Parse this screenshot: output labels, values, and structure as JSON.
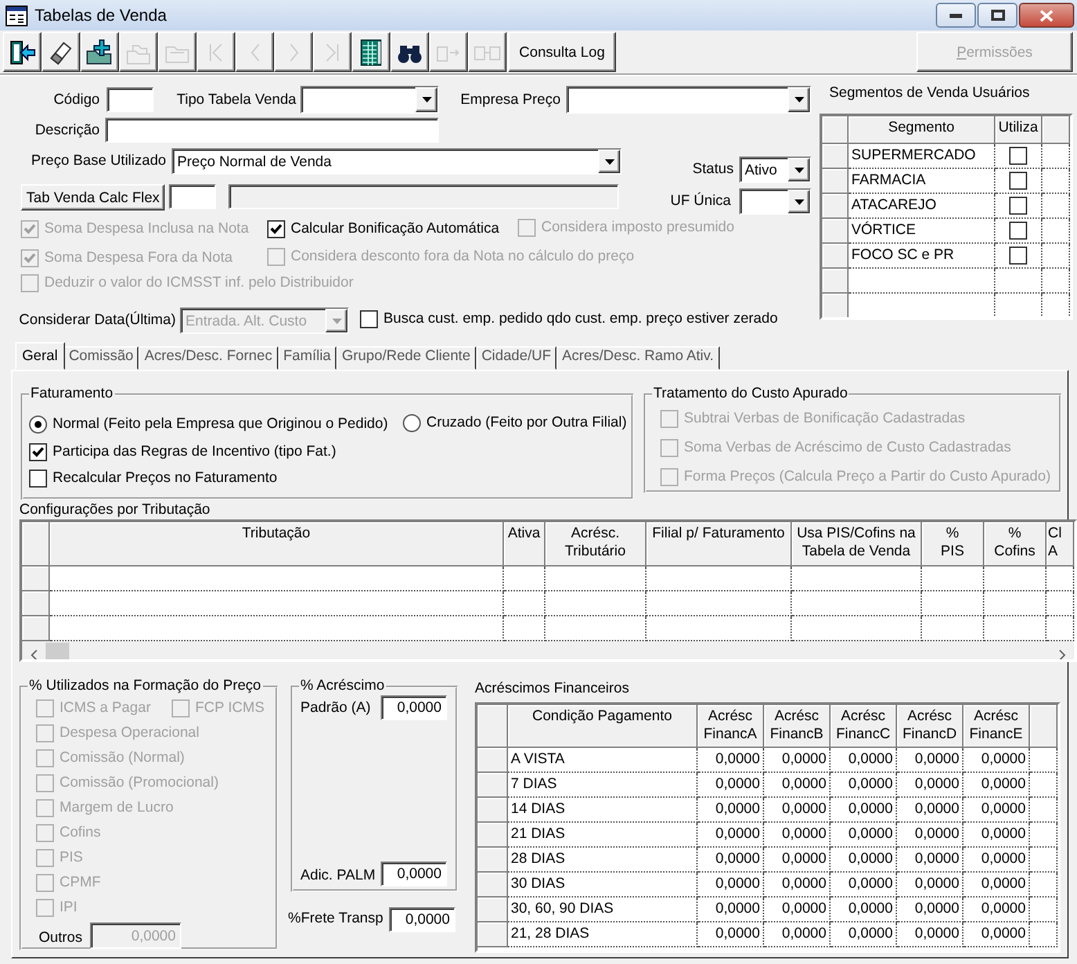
{
  "window": {
    "title": "Tabelas de Venda"
  },
  "toolbar": {
    "buttons": [
      {
        "kind": "exit",
        "disabled": false
      },
      {
        "kind": "eraser",
        "disabled": false
      },
      {
        "kind": "folder_add",
        "disabled": false
      },
      {
        "kind": "folder_edit",
        "disabled": true
      },
      {
        "kind": "folder_remove",
        "disabled": true
      },
      {
        "kind": "first",
        "disabled": true
      },
      {
        "kind": "previous",
        "disabled": true
      },
      {
        "kind": "next",
        "disabled": true
      },
      {
        "kind": "last",
        "disabled": true
      },
      {
        "kind": "grid",
        "disabled": false
      },
      {
        "kind": "find",
        "disabled": false
      },
      {
        "kind": "export",
        "disabled": true
      },
      {
        "kind": "transfer",
        "disabled": true
      },
      {
        "kind": "text",
        "label": "Consulta Log",
        "disabled": false
      }
    ],
    "permissions": {
      "label": "Permissões",
      "disabled": true
    }
  },
  "form": {
    "code": {
      "label": "Código"
    },
    "table_type": {
      "label": "Tipo Tabela Venda"
    },
    "price_company": {
      "label": "Empresa Preço"
    },
    "description": {
      "label": "Descrição"
    },
    "base_price": {
      "label": "Preço Base Utilizado",
      "value": "Preço Normal de Venda"
    },
    "status": {
      "label": "Status",
      "value": "Ativo"
    },
    "calc_flex": {
      "button": "Tab Venda Calc Flex"
    },
    "single_uf": {
      "label": "UF Única"
    },
    "options": [
      {
        "label": "Soma Despesa Inclusa na Nota",
        "checked": true,
        "disabled": true
      },
      {
        "label": "Calcular Bonificação Automática",
        "checked": true,
        "disabled": false
      },
      {
        "label": "Considera imposto presumido",
        "checked": false,
        "disabled": true
      },
      {
        "label": "Soma Despesa Fora da Nota",
        "checked": true,
        "disabled": true
      },
      {
        "label": "Considera desconto fora da Nota no cálculo do preço",
        "checked": false,
        "disabled": true
      },
      {
        "label": "Deduzir o valor do ICMSST inf. pelo Distribuidor",
        "checked": false,
        "disabled": true
      }
    ],
    "date_basis": {
      "label": "Considerar Data(Última)",
      "value": "Entrada. Alt. Custo",
      "disabled": true
    },
    "zero_cost_search": {
      "label": "Busca cust. emp. pedido qdo cust. emp. preço estiver zerado",
      "checked": false,
      "disabled": false
    }
  },
  "segments": {
    "title": "Segmentos de Venda Usuários",
    "columns": [
      "Segmento",
      "Utiliza"
    ],
    "rows": [
      {
        "name": "SUPERMERCADO",
        "checked": false
      },
      {
        "name": "FARMACIA",
        "checked": false
      },
      {
        "name": "ATACAREJO",
        "checked": false
      },
      {
        "name": "VÓRTICE",
        "checked": false
      },
      {
        "name": "FOCO SC e PR",
        "checked": false
      }
    ]
  },
  "tabs": [
    {
      "label": "Geral",
      "selected": true
    },
    {
      "label": "Comissão",
      "selected": false
    },
    {
      "label": "Acres/Desc. Fornec",
      "selected": false
    },
    {
      "label": "Família",
      "selected": false
    },
    {
      "label": "Grupo/Rede Cliente",
      "selected": false
    },
    {
      "label": "Cidade/UF",
      "selected": false
    },
    {
      "label": "Acres/Desc. Ramo Ativ.",
      "selected": false
    }
  ],
  "billing": {
    "title": "Faturamento",
    "modes": [
      {
        "label": "Normal (Feito pela Empresa que Originou o Pedido)",
        "selected": true
      },
      {
        "label": "Cruzado (Feito por Outra Filial)",
        "selected": false
      }
    ],
    "options": [
      {
        "label": "Participa das Regras de Incentivo (tipo Fat.)",
        "checked": true
      },
      {
        "label": "Recalcular Preços no Faturamento",
        "checked": false
      }
    ]
  },
  "cost_treatment": {
    "title": "Tratamento do Custo Apurado",
    "options": [
      {
        "label": "Subtrai Verbas de Bonificação Cadastradas",
        "checked": false,
        "disabled": true
      },
      {
        "label": "Soma Verbas de Acréscimo de Custo Cadastradas",
        "checked": false,
        "disabled": true
      },
      {
        "label": "Forma Preços (Calcula Preço a Partir do Custo Apurado)",
        "checked": false,
        "disabled": true
      }
    ]
  },
  "taxation": {
    "title": "Configurações por Tributação",
    "columns": [
      "Tributação",
      "Ativa",
      "Acrésc. Tributário",
      "Filial p/ Faturamento",
      "Usa PIS/Cofins na Tabela de Venda",
      "% PIS",
      "% Cofins",
      "Cl A"
    ]
  },
  "price_components": {
    "title": "% Utilizados na Formação do Preço",
    "options": [
      {
        "label": "ICMS a Pagar",
        "checked": false,
        "disabled": true
      },
      {
        "label": "FCP ICMS",
        "checked": false,
        "disabled": true
      },
      {
        "label": "Despesa Operacional",
        "checked": false,
        "disabled": true
      },
      {
        "label": "Comissão (Normal)",
        "checked": false,
        "disabled": true
      },
      {
        "label": "Comissão (Promocional)",
        "checked": false,
        "disabled": true
      },
      {
        "label": "Margem de Lucro",
        "checked": false,
        "disabled": true
      },
      {
        "label": "Cofins",
        "checked": false,
        "disabled": true
      },
      {
        "label": "PIS",
        "checked": false,
        "disabled": true
      },
      {
        "label": "CPMF",
        "checked": false,
        "disabled": true
      },
      {
        "label": "IPI",
        "checked": false,
        "disabled": true
      }
    ],
    "others": {
      "label": "Outros",
      "value": "0,0000"
    }
  },
  "markup": {
    "title": "% Acréscimo",
    "standard": {
      "label": "Padrão (A)",
      "value": "0,0000"
    },
    "palm": {
      "label": "Adic. PALM",
      "value": "0,0000"
    }
  },
  "freight": {
    "label": "%Frete Transp",
    "value": "0,0000"
  },
  "financial": {
    "title": "Acréscimos Financeiros",
    "columns": [
      "Condição Pagamento",
      "Acrésc FinancA",
      "Acrésc FinancB",
      "Acrésc FinancC",
      "Acrésc FinancD",
      "Acrésc FinancE"
    ],
    "rows": [
      {
        "condition": "A VISTA",
        "values": [
          "0,0000",
          "0,0000",
          "0,0000",
          "0,0000",
          "0,0000"
        ]
      },
      {
        "condition": "7 DIAS",
        "values": [
          "0,0000",
          "0,0000",
          "0,0000",
          "0,0000",
          "0,0000"
        ]
      },
      {
        "condition": "14 DIAS",
        "values": [
          "0,0000",
          "0,0000",
          "0,0000",
          "0,0000",
          "0,0000"
        ]
      },
      {
        "condition": "21 DIAS",
        "values": [
          "0,0000",
          "0,0000",
          "0,0000",
          "0,0000",
          "0,0000"
        ]
      },
      {
        "condition": "28 DIAS",
        "values": [
          "0,0000",
          "0,0000",
          "0,0000",
          "0,0000",
          "0,0000"
        ]
      },
      {
        "condition": "30 DIAS",
        "values": [
          "0,0000",
          "0,0000",
          "0,0000",
          "0,0000",
          "0,0000"
        ]
      },
      {
        "condition": "30, 60, 90 DIAS",
        "values": [
          "0,0000",
          "0,0000",
          "0,0000",
          "0,0000",
          "0,0000"
        ]
      },
      {
        "condition": "21, 28 DIAS",
        "values": [
          "0,0000",
          "0,0000",
          "0,0000",
          "0,0000",
          "0,0000"
        ]
      }
    ]
  }
}
